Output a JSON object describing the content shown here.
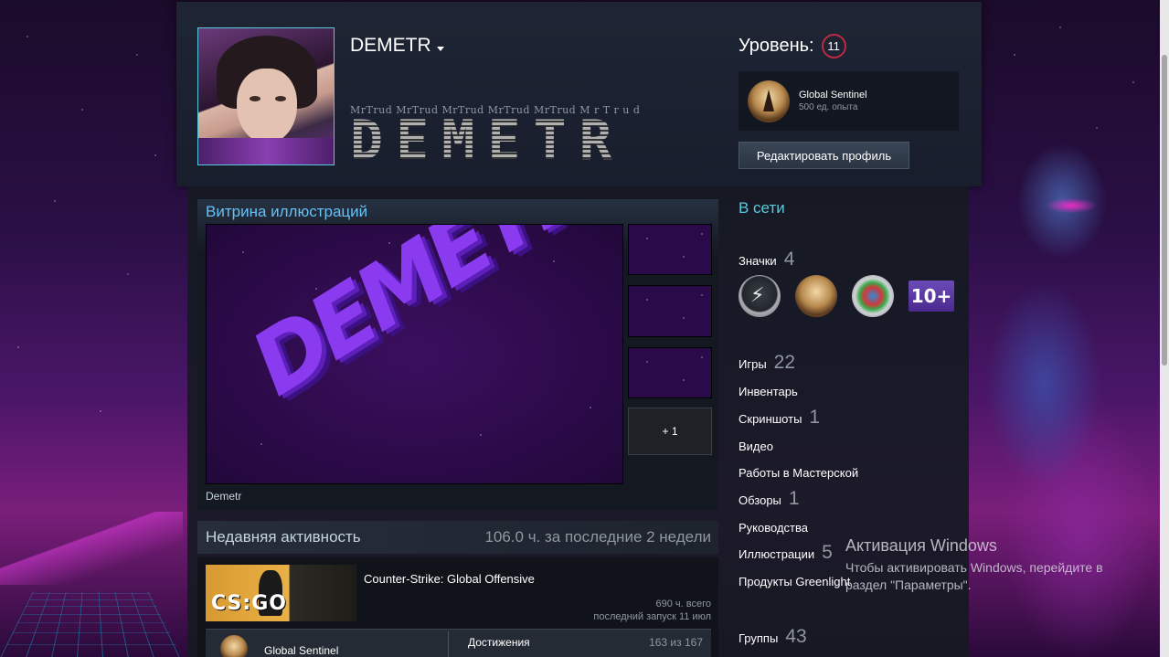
{
  "profile": {
    "username": "DEMETR",
    "mrtrud_line": "MrTrud MrTrud MrTrud MrTrud MrTrud M r T r u d",
    "big_name": "DEMETR",
    "level_label": "Уровень:",
    "level": "11",
    "featured_badge": {
      "name": "Global Sentinel",
      "xp": "500 ед. опыта"
    },
    "edit_button": "Редактировать профиль"
  },
  "showcase": {
    "title": "Витрина иллюстраций",
    "art_text": "DEMETR",
    "more_label": "+ 1",
    "caption": "Demetr"
  },
  "activity": {
    "title": "Недавняя активность",
    "hours": "106.0 ч. за последние 2 недели",
    "game": {
      "name": "Counter-Strike: Global Offensive",
      "capsule_logo": "CS:GO",
      "total": "690 ч. всего",
      "last_played": "последний запуск 11 июл",
      "badge_name": "Global Sentinel",
      "achievements_label": "Достижения",
      "achievements_count": "163 из 167"
    }
  },
  "sidebar": {
    "status": "В сети",
    "badges": {
      "label": "Значки",
      "count": "4",
      "tenplus": "10+"
    },
    "games": {
      "label": "Игры",
      "count": "22"
    },
    "inventory": {
      "label": "Инвентарь"
    },
    "screenshots": {
      "label": "Скриншоты",
      "count": "1"
    },
    "videos": {
      "label": "Видео"
    },
    "workshop": {
      "label": "Работы в Мастерской"
    },
    "reviews": {
      "label": "Обзоры",
      "count": "1"
    },
    "guides": {
      "label": "Руководства"
    },
    "artwork": {
      "label": "Иллюстрации",
      "count": "5"
    },
    "greenlight": {
      "label": "Продукты Greenlight"
    },
    "groups": {
      "label": "Группы",
      "count": "43"
    }
  },
  "watermark": {
    "title": "Активация Windows",
    "line1": "Чтобы активировать Windows, перейдите в",
    "line2": "раздел \"Параметры\"."
  },
  "colors": {
    "accent_blue": "#66c0f4",
    "online": "#57cbde",
    "level_ring": "#c02942"
  }
}
